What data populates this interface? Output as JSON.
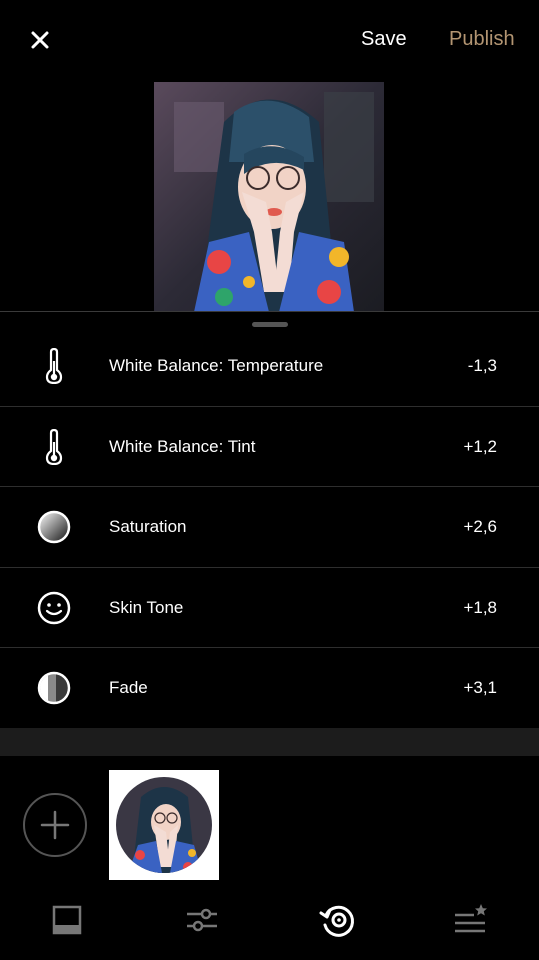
{
  "header": {
    "close_icon": "close-icon",
    "save_label": "Save",
    "publish_label": "Publish",
    "publish_color": "#b39572"
  },
  "adjustments": [
    {
      "label": "White Balance: Temperature",
      "value": "-1,3",
      "icon": "thermometer-icon"
    },
    {
      "label": "White Balance: Tint",
      "value": "+1,2",
      "icon": "thermometer-icon"
    },
    {
      "label": "Saturation",
      "value": "+2,6",
      "icon": "saturation-icon"
    },
    {
      "label": "Skin Tone",
      "value": "+1,8",
      "icon": "smiley-face-icon"
    },
    {
      "label": "Fade",
      "value": "+3,1",
      "icon": "fade-icon"
    }
  ],
  "bottom_nav": [
    {
      "name": "presets",
      "icon": "presets-icon",
      "active": false
    },
    {
      "name": "adjust",
      "icon": "sliders-icon",
      "active": false
    },
    {
      "name": "history",
      "icon": "history-recipe-icon",
      "active": true
    },
    {
      "name": "recipes",
      "icon": "recipes-star-icon",
      "active": false
    }
  ]
}
